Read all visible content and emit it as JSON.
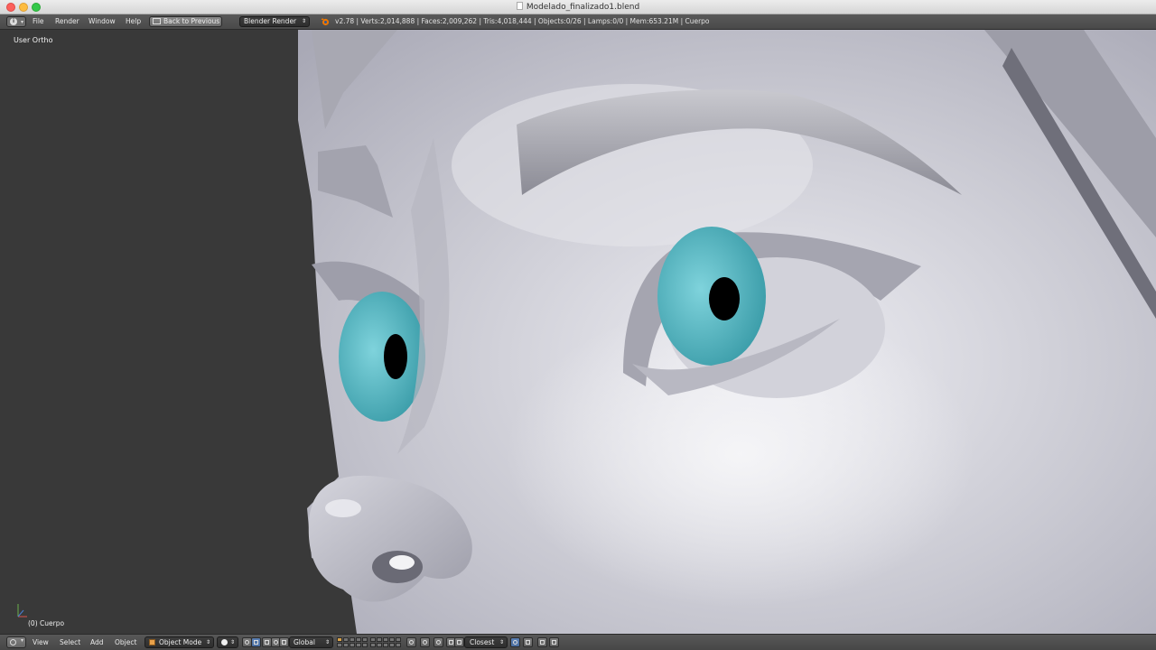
{
  "window": {
    "title": "Modelado_finalizado1.blend",
    "colors": {
      "close": "#fc605c",
      "minimize": "#fdbc40",
      "zoom": "#34c84a"
    }
  },
  "info_header": {
    "editor_icon": "info-icon",
    "menu": [
      "File",
      "Render",
      "Window",
      "Help"
    ],
    "back_button": "Back to Previous",
    "render_engine": "Blender Render",
    "stats": "v2.78 | Verts:2,014,888 | Faces:2,009,262 | Tris:4,018,444 | Objects:0/26 | Lamps:0/0 | Mem:653.21M | Cuerpo"
  },
  "viewport": {
    "view_label": "User Ortho",
    "object_label": "(0) Cuerpo",
    "colors": {
      "background": "#393939",
      "iris": "#4fb3bf",
      "pupil": "#000000",
      "skin": "#d8d8de"
    }
  },
  "view3d_header": {
    "editor_icon": "3d-view-icon",
    "menu": [
      "View",
      "Select",
      "Add",
      "Object"
    ],
    "mode": "Object Mode",
    "pivot_icon": "pivot-point-icon",
    "orientation": "Global",
    "snap_element": "Closest"
  }
}
